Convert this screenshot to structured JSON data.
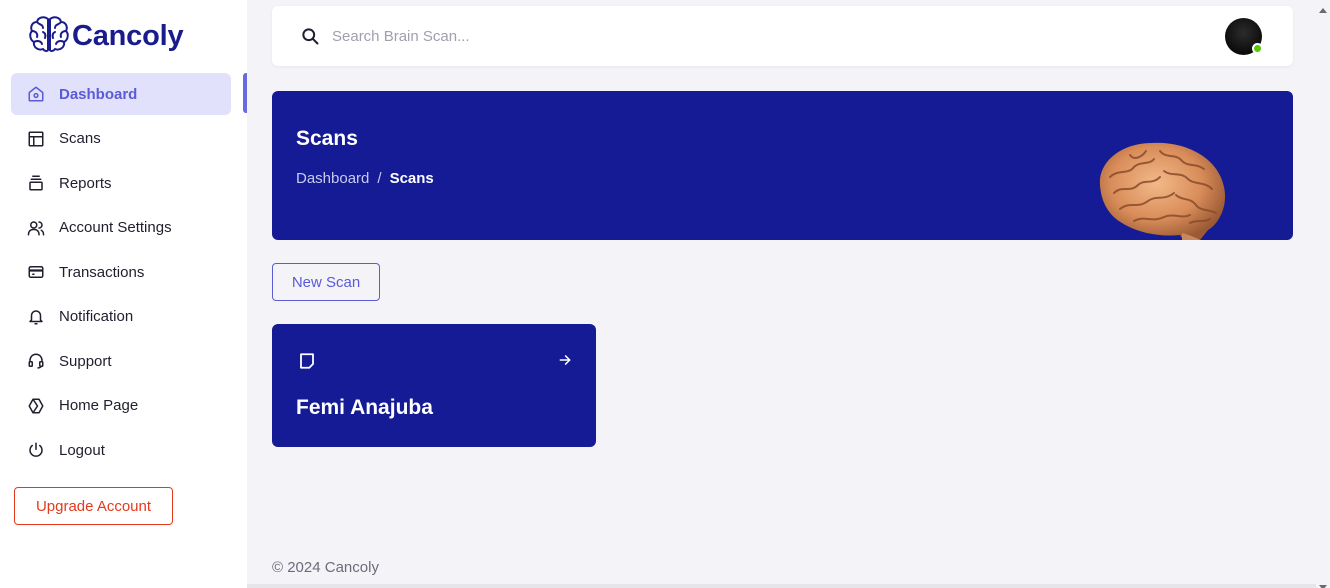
{
  "app": {
    "name": "Cancoly"
  },
  "sidebar": {
    "items": [
      {
        "label": "Dashboard",
        "icon": "home-icon",
        "active": true
      },
      {
        "label": "Scans",
        "icon": "layout-icon",
        "active": false
      },
      {
        "label": "Reports",
        "icon": "stack-icon",
        "active": false
      },
      {
        "label": "Account Settings",
        "icon": "users-icon",
        "active": false
      },
      {
        "label": "Transactions",
        "icon": "credit-card-icon",
        "active": false
      },
      {
        "label": "Notification",
        "icon": "bell-icon",
        "active": false
      },
      {
        "label": "Support",
        "icon": "headset-icon",
        "active": false
      },
      {
        "label": "Home Page",
        "icon": "hexagon-icon",
        "active": false
      },
      {
        "label": "Logout",
        "icon": "power-icon",
        "active": false
      }
    ],
    "upgrade_label": "Upgrade Account"
  },
  "search": {
    "placeholder": "Search Brain Scan..."
  },
  "banner": {
    "title": "Scans",
    "breadcrumb": {
      "parent": "Dashboard",
      "separator": "/",
      "current": "Scans"
    }
  },
  "actions": {
    "new_scan_label": "New Scan"
  },
  "scans": [
    {
      "name": "Femi Anajuba"
    }
  ],
  "footer": {
    "text": "© 2024 Cancoly"
  },
  "colors": {
    "brand": "#1a1c8c",
    "banner": "#151b94",
    "accent": "#5b5bd6",
    "danger": "#e5391c",
    "online": "#56ca00"
  }
}
